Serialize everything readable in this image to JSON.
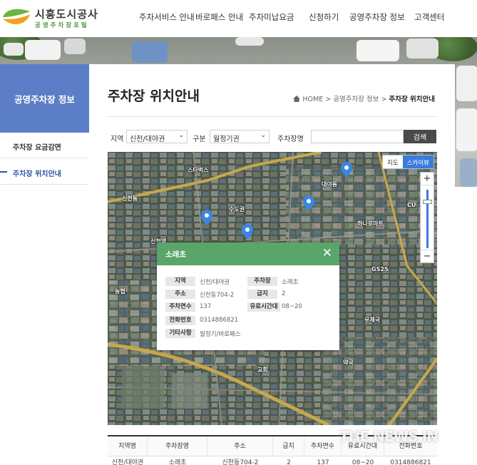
{
  "brand": {
    "title": "시흥도시공사",
    "subtitle": "공영주차장포털"
  },
  "gnb": [
    "주차서비스 안내",
    "바로패스 안내",
    "주차미납요금",
    "신청하기",
    "공영주차장 정보",
    "고객센터"
  ],
  "sidebar": {
    "title": "공영주차장 정보",
    "items": [
      {
        "label": "주차장 요금감면",
        "active": false
      },
      {
        "label": "주차장 위치안내",
        "active": true
      }
    ]
  },
  "page": {
    "title": "주차장 위치안내",
    "breadcrumb": {
      "home": "HOME",
      "parent": "공영주차장 정보",
      "current": "주차장 위치안내",
      "sep": ">"
    }
  },
  "search": {
    "region_label": "지역",
    "region_value": "신천/대야권",
    "type_label": "구분",
    "type_value": "월정기권",
    "name_label": "주차장명",
    "name_value": "",
    "button": "검색"
  },
  "map": {
    "type_buttons": [
      "지도",
      "스카이뷰"
    ],
    "zoom_in": "+",
    "zoom_out": "−",
    "labels": [
      "스타벅스",
      "신천동",
      "대야동",
      "수도권",
      "신천역",
      "하나로마트",
      "CU",
      "GS25",
      "농협",
      "우체국",
      "약국",
      "교회"
    ]
  },
  "popup": {
    "title": "소래초",
    "close": "✕",
    "fields": [
      {
        "label": "지역",
        "value": "신천/대야권"
      },
      {
        "label": "주차장",
        "value": "소래초"
      },
      {
        "label": "주소",
        "value": "신천동704-2"
      },
      {
        "label": "급지",
        "value": "2"
      },
      {
        "label": "주차면수",
        "value": "137"
      },
      {
        "label": "유료시간대",
        "value": "08~20"
      },
      {
        "label": "전화번호",
        "value": "0314886821"
      },
      {
        "label": "기타사항",
        "value": "월정기/바로패스"
      }
    ]
  },
  "table": {
    "headers": [
      "지역명",
      "주차장명",
      "주소",
      "급지",
      "주차면수",
      "유료시간대",
      "전화번호"
    ],
    "row": [
      "신천/대야권",
      "소래초",
      "신천동704-2",
      "2",
      "137",
      "08~20",
      "0314886821"
    ]
  },
  "watermark": "THE NEWS IN",
  "colors": {
    "sidebar_head": "#5b7ec6",
    "active": "#2f55a3",
    "popup_head": "#5aa56a",
    "search_button": "#4a4a4a",
    "map_type_active": "#3a7bdc"
  }
}
